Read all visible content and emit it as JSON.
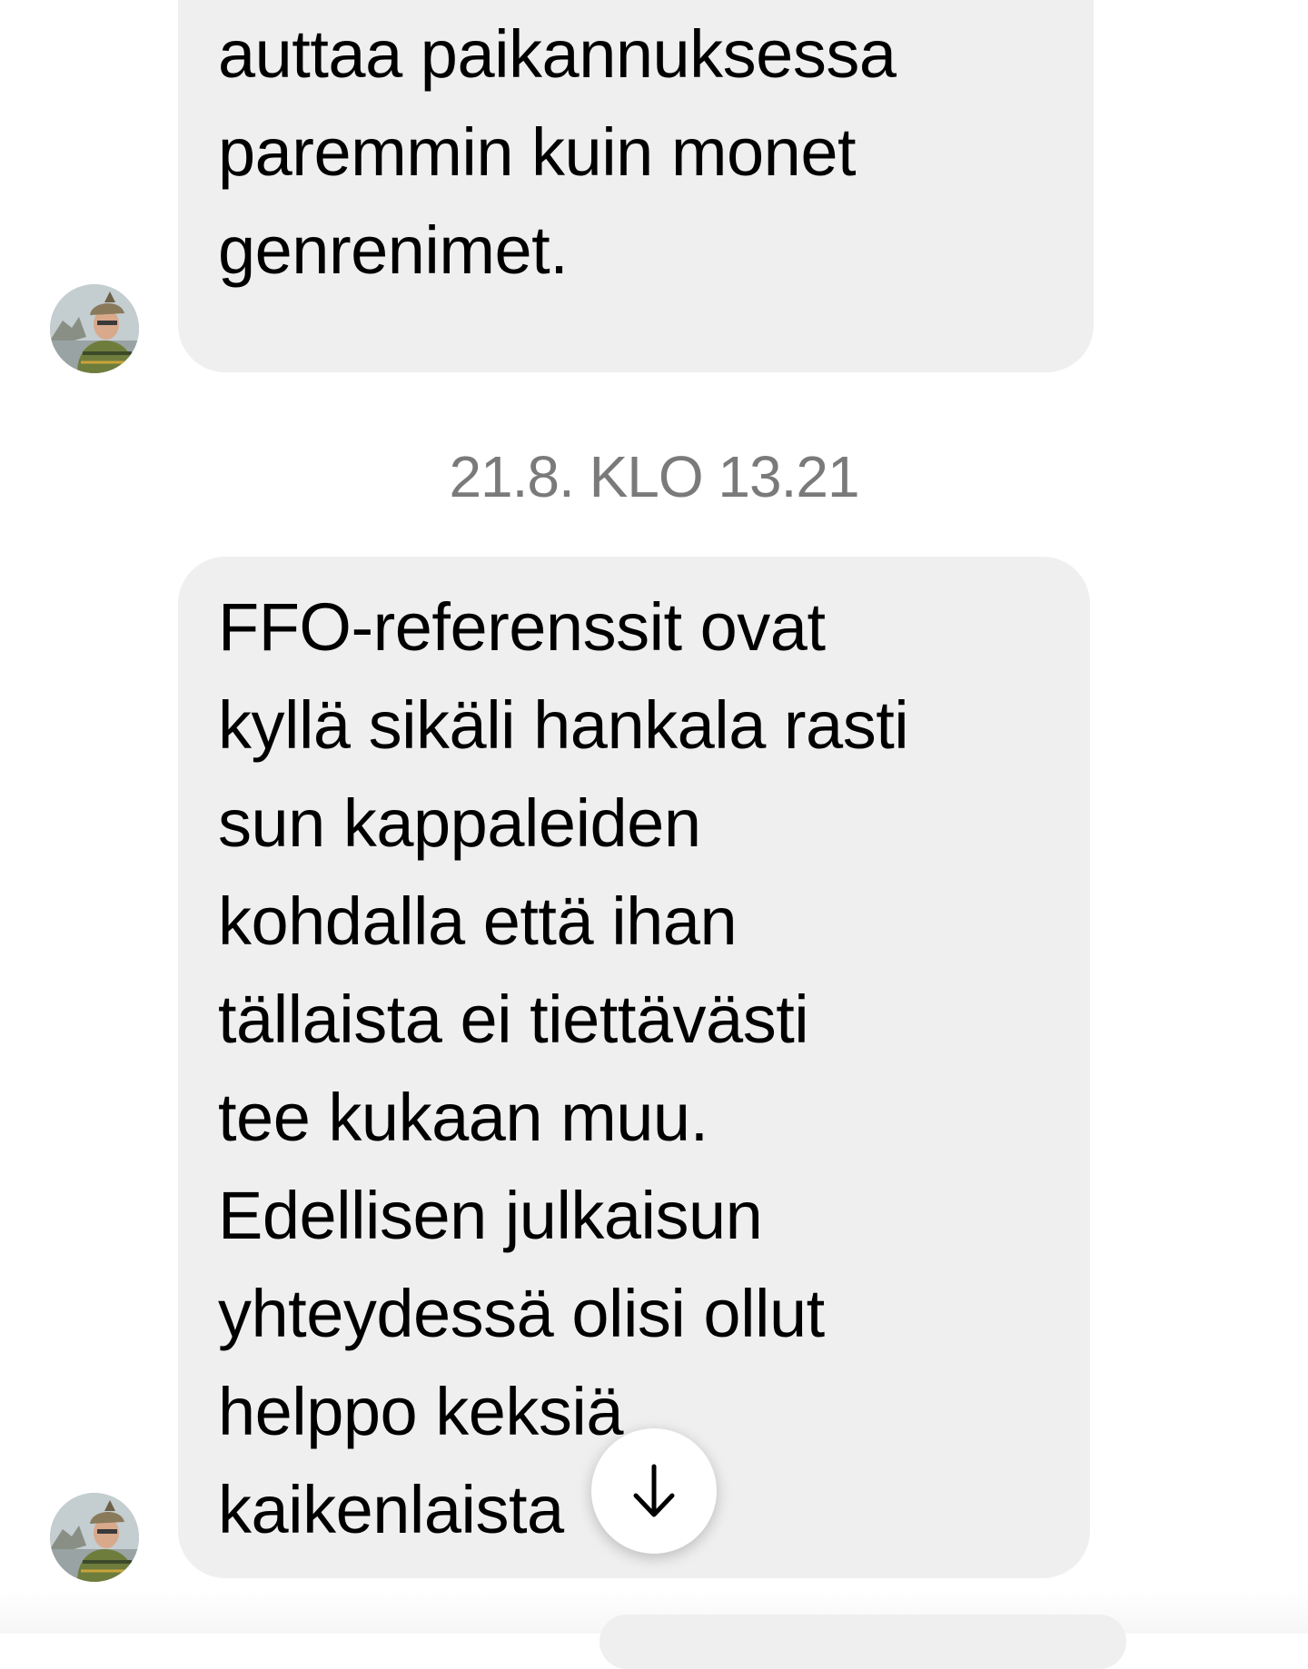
{
  "messages": [
    {
      "sender": "other",
      "text": "-merkintä saattaa\nauttaa paikannuksessa\nparemmin kuin monet\ngenrenimet."
    },
    {
      "sender": "other",
      "text": "FFO-referenssit ovat\nkyllä sikäli hankala rasti\nsun kappaleiden\nkohdalla että ihan\ntällaista ei tiettävästi\ntee kukaan muu.\nEdellisen julkaisun\nyhteydessä olisi ollut\nhelppo keksiä\nkaikenlaista"
    }
  ],
  "timestamp": "21.8. KLO 13.21",
  "icons": {
    "avatar": "profile-photo",
    "scroll_down": "arrow-down-icon"
  },
  "colors": {
    "bubble_background": "#efefef",
    "timestamp_text": "#7a7a7a",
    "page_background": "#ffffff"
  }
}
